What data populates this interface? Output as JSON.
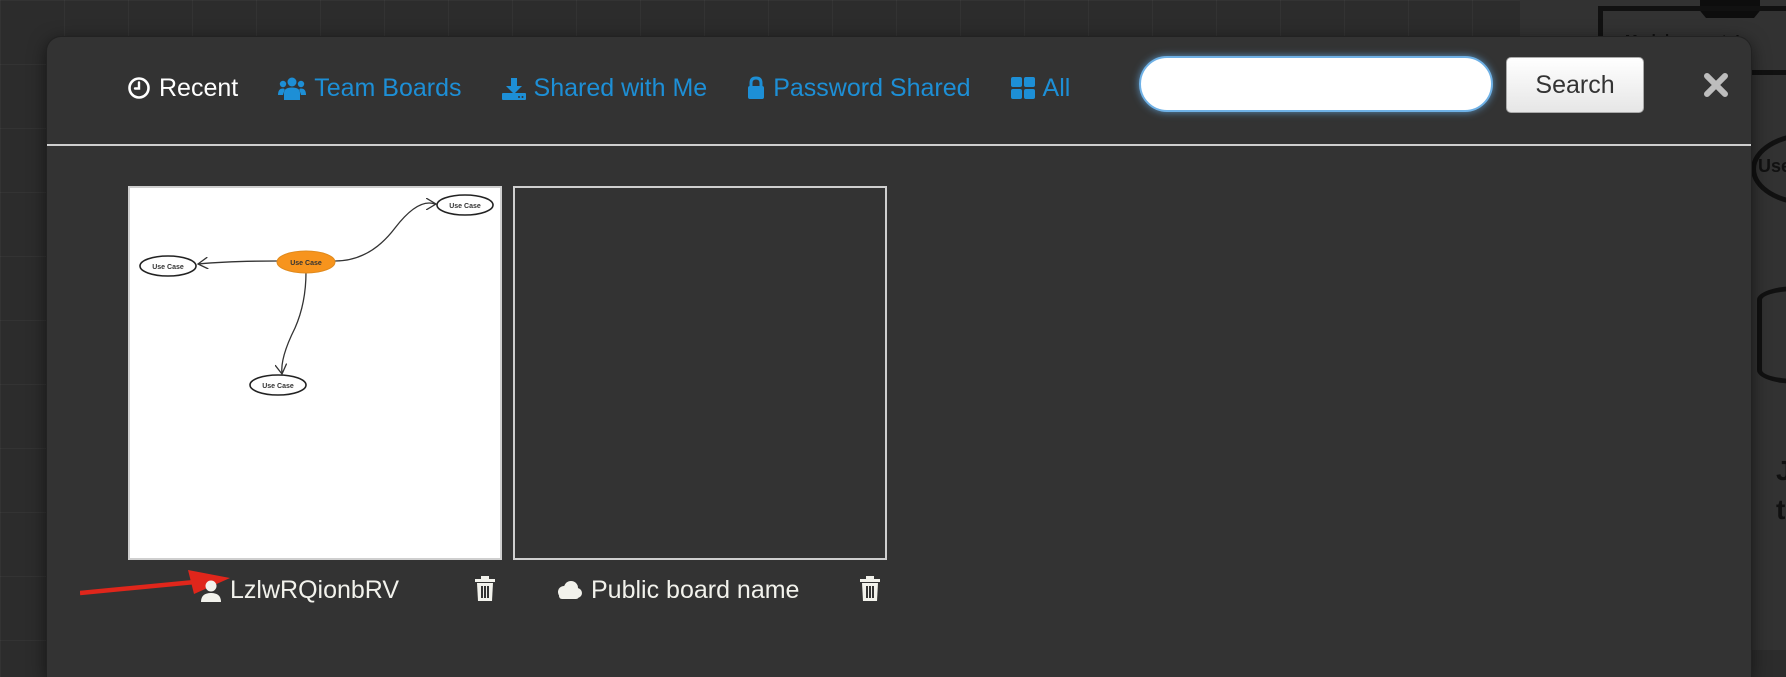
{
  "background": {
    "box_text": "Markdown note!",
    "ellipse_text": "Use",
    "letters": [
      "J",
      "t"
    ]
  },
  "modal": {
    "nav": [
      {
        "label": "Recent",
        "icon": "clock-icon",
        "active": true
      },
      {
        "label": "Team Boards",
        "icon": "users-icon",
        "active": false
      },
      {
        "label": "Shared with Me",
        "icon": "download-icon",
        "active": false
      },
      {
        "label": "Password Shared",
        "icon": "lock-icon",
        "active": false
      },
      {
        "label": "All",
        "icon": "grid-icon",
        "active": false
      }
    ],
    "search": {
      "value": "",
      "placeholder": "",
      "button_label": "Search"
    },
    "close_icon": "close-icon",
    "accent_color": "#1d8fd6",
    "boards": [
      {
        "name": "LzlwRQionbRV",
        "owner_icon": "user-icon",
        "delete_icon": "trash-icon",
        "thumbnail": {
          "nodes": [
            {
              "label": "Use Case",
              "highlight": true
            },
            {
              "label": "Use Case",
              "highlight": false
            },
            {
              "label": "Use Case",
              "highlight": false
            },
            {
              "label": "Use Case",
              "highlight": false
            }
          ],
          "highlight_color": "#f7941d"
        }
      },
      {
        "name": "Public board name",
        "owner_icon": "cloud-icon",
        "delete_icon": "trash-icon",
        "thumbnail": null
      }
    ],
    "annotation_color": "#e0261b"
  }
}
